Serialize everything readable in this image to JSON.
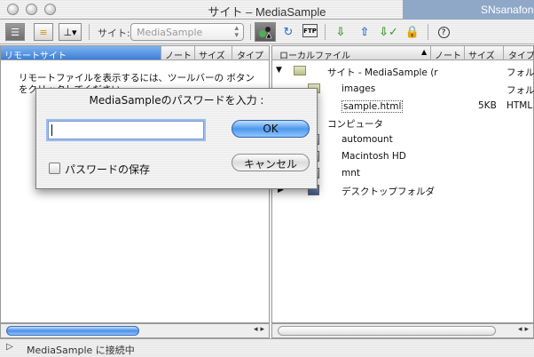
{
  "window": {
    "title": "サイト – MediaSample",
    "bg_corner_text": "SNsanafon"
  },
  "toolbar": {
    "site_label": "サイト:",
    "site_value": "MediaSample",
    "ftp_label": "FTP"
  },
  "remote_pane": {
    "headers": [
      "リモートサイト",
      "ノート",
      "サイズ",
      "タイプ"
    ],
    "message": "リモートファイルを表示するには、ツールバーの ボタンをクリックしてください。"
  },
  "local_pane": {
    "headers": [
      "ローカルファイル",
      "ノート",
      "サイズ",
      "タイプ"
    ],
    "rows": [
      {
        "name": "サイト - MediaSample (r",
        "size": "",
        "type": "フォル"
      },
      {
        "name": "images",
        "size": "",
        "type": "フォル"
      },
      {
        "name": "sample.html",
        "size": "5KB",
        "type": "HTML"
      },
      {
        "name": "コンピュータ",
        "size": "",
        "type": ""
      },
      {
        "name": "automount",
        "size": "",
        "type": ""
      },
      {
        "name": "Macintosh HD",
        "size": "",
        "type": ""
      },
      {
        "name": "mnt",
        "size": "",
        "type": ""
      },
      {
        "name": "デスクトップフォルダ",
        "size": "",
        "type": ""
      }
    ]
  },
  "dialog": {
    "title": "MediaSampleのパスワードを入力 :",
    "password_value": "",
    "ok_label": "OK",
    "cancel_label": "キャンセル",
    "save_password_label": "パスワードの保存",
    "save_password_checked": false
  },
  "status": {
    "text": "MediaSample に接続中"
  },
  "colors": {
    "selection_blue": "#3c7fd9",
    "default_button": "#4f97ec"
  }
}
